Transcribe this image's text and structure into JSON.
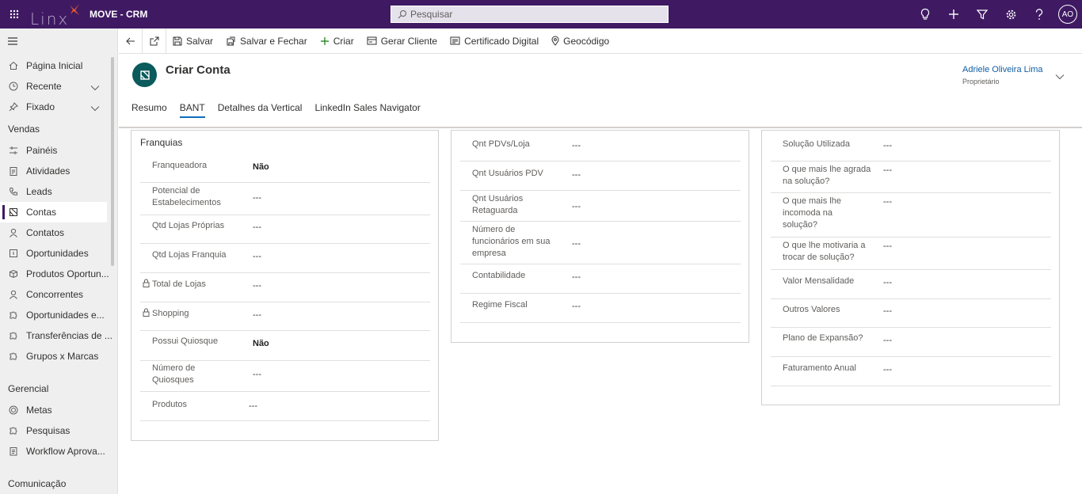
{
  "topbar": {
    "logo_text": "Linx",
    "app_name": "MOVE - CRM",
    "search_placeholder": "Pesquisar",
    "avatar_initials": "AO",
    "icons": [
      "waffle-icon",
      "lightbulb-icon",
      "plus-icon",
      "filter-icon",
      "gear-icon",
      "help-icon"
    ]
  },
  "sidebar": {
    "items_top": [
      {
        "label": "Página Inicial",
        "icon": "home-icon"
      },
      {
        "label": "Recente",
        "icon": "clock-icon",
        "chevron": true
      },
      {
        "label": "Fixado",
        "icon": "pin-icon",
        "chevron": true
      }
    ],
    "groups": [
      {
        "title": "Vendas",
        "items": [
          {
            "label": "Painéis",
            "icon": "dashboard-icon"
          },
          {
            "label": "Atividades",
            "icon": "clipboard-icon"
          },
          {
            "label": "Leads",
            "icon": "phone-icon"
          },
          {
            "label": "Contas",
            "icon": "account-icon",
            "selected": true
          },
          {
            "label": "Contatos",
            "icon": "person-icon"
          },
          {
            "label": "Oportunidades",
            "icon": "opportunity-icon"
          },
          {
            "label": "Produtos Oportun...",
            "icon": "box-icon"
          },
          {
            "label": "Concorrentes",
            "icon": "person-icon"
          },
          {
            "label": "Oportunidades e...",
            "icon": "puzzle-icon"
          },
          {
            "label": "Transferências de ...",
            "icon": "puzzle-icon"
          },
          {
            "label": "Grupos x Marcas",
            "icon": "puzzle-icon"
          }
        ]
      },
      {
        "title": "Gerencial",
        "items": [
          {
            "label": "Metas",
            "icon": "target-icon"
          },
          {
            "label": "Pesquisas",
            "icon": "puzzle-icon"
          },
          {
            "label": "Workflow Aprova...",
            "icon": "document-icon"
          }
        ]
      },
      {
        "title": "Comunicação",
        "items": []
      }
    ]
  },
  "commandbar": {
    "commands": [
      {
        "label": "Salvar",
        "icon": "save-icon"
      },
      {
        "label": "Salvar e Fechar",
        "icon": "save-close-icon"
      },
      {
        "label": "Criar",
        "icon": "plus-icon"
      },
      {
        "label": "Gerar Cliente",
        "icon": "card-icon"
      },
      {
        "label": "Certificado Digital",
        "icon": "certificate-icon"
      },
      {
        "label": "Geocódigo",
        "icon": "location-icon"
      }
    ]
  },
  "header": {
    "title": "Criar Conta",
    "owner_name": "Adriele Oliveira Lima",
    "owner_label": "Proprietário",
    "tabs": [
      "Resumo",
      "BANT",
      "Detalhes da Vertical",
      "LinkedIn Sales Navigator"
    ],
    "active_tab": "BANT"
  },
  "sections": {
    "franquias": {
      "title": "Franquias",
      "fields": [
        {
          "label": "Franqueadora",
          "value": "Não"
        },
        {
          "label": "Potencial de Estabelecimentos",
          "value": "---"
        },
        {
          "label": "Qtd Lojas Próprias",
          "value": "---"
        },
        {
          "label": "Qtd Lojas Franquia",
          "value": "---"
        },
        {
          "label": "Total de Lojas",
          "value": "---",
          "locked": true
        },
        {
          "label": "Shopping",
          "value": "---",
          "locked": true
        },
        {
          "label": "Possui Quiosque",
          "value": "Não"
        },
        {
          "label": "Número de Quiosques",
          "value": "---"
        },
        {
          "label": "Produtos",
          "value": "---"
        }
      ]
    },
    "middle": {
      "fields": [
        {
          "label": "Qnt PDVs/Loja",
          "value": "---"
        },
        {
          "label": "Qnt Usuários PDV",
          "value": "---"
        },
        {
          "label": "Qnt Usuários Retaguarda",
          "value": "---"
        },
        {
          "label": "Número de funcionários em sua empresa",
          "value": "---"
        },
        {
          "label": "Contabilidade",
          "value": "---"
        },
        {
          "label": "Regime Fiscal",
          "value": "---"
        }
      ]
    },
    "right": {
      "fields": [
        {
          "label": "Solução Utilizada",
          "value": "---"
        },
        {
          "label": "O que mais lhe agrada na solução?",
          "value": "---"
        },
        {
          "label": "O que mais lhe incomoda na solução?",
          "value": "---"
        },
        {
          "label": "O que lhe motivaria a trocar de solução?",
          "value": "---"
        },
        {
          "label": "Valor Mensalidade",
          "value": "---"
        },
        {
          "label": "Outros Valores",
          "value": "---"
        },
        {
          "label": "Plano de Expansão?",
          "value": "---"
        },
        {
          "label": "Faturamento Anual",
          "value": "---"
        }
      ]
    }
  }
}
